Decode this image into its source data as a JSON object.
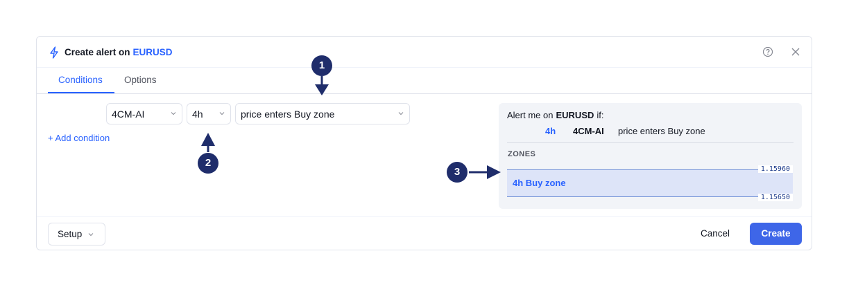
{
  "dialog": {
    "title_prefix": "Create alert on",
    "symbol": "EURUSD",
    "help_icon": "help-circle-icon",
    "close_icon": "close-icon"
  },
  "tabs": [
    {
      "label": "Conditions",
      "active": true
    },
    {
      "label": "Options",
      "active": false
    }
  ],
  "condition": {
    "indicator": "4CM-AI",
    "timeframe": "4h",
    "operator": "price enters Buy zone",
    "add_label": "+ Add condition"
  },
  "preview": {
    "alert_prefix": "Alert me on",
    "symbol": "EURUSD",
    "alert_suffix": "if:",
    "timeframe": "4h",
    "indicator": "4CM-AI",
    "condition": "price enters Buy zone",
    "zones_title": "ZONES",
    "zone": {
      "label": "4h Buy zone",
      "upper": "1.15960",
      "lower": "1.15650"
    }
  },
  "footer": {
    "setup_label": "Setup",
    "cancel_label": "Cancel",
    "create_label": "Create"
  },
  "annotations": [
    "1",
    "2",
    "3"
  ],
  "colors": {
    "accent": "#2962ff",
    "create_button": "#3e66e8",
    "annotation": "#1f2d6b",
    "zone_fill": "#dde4f8"
  }
}
